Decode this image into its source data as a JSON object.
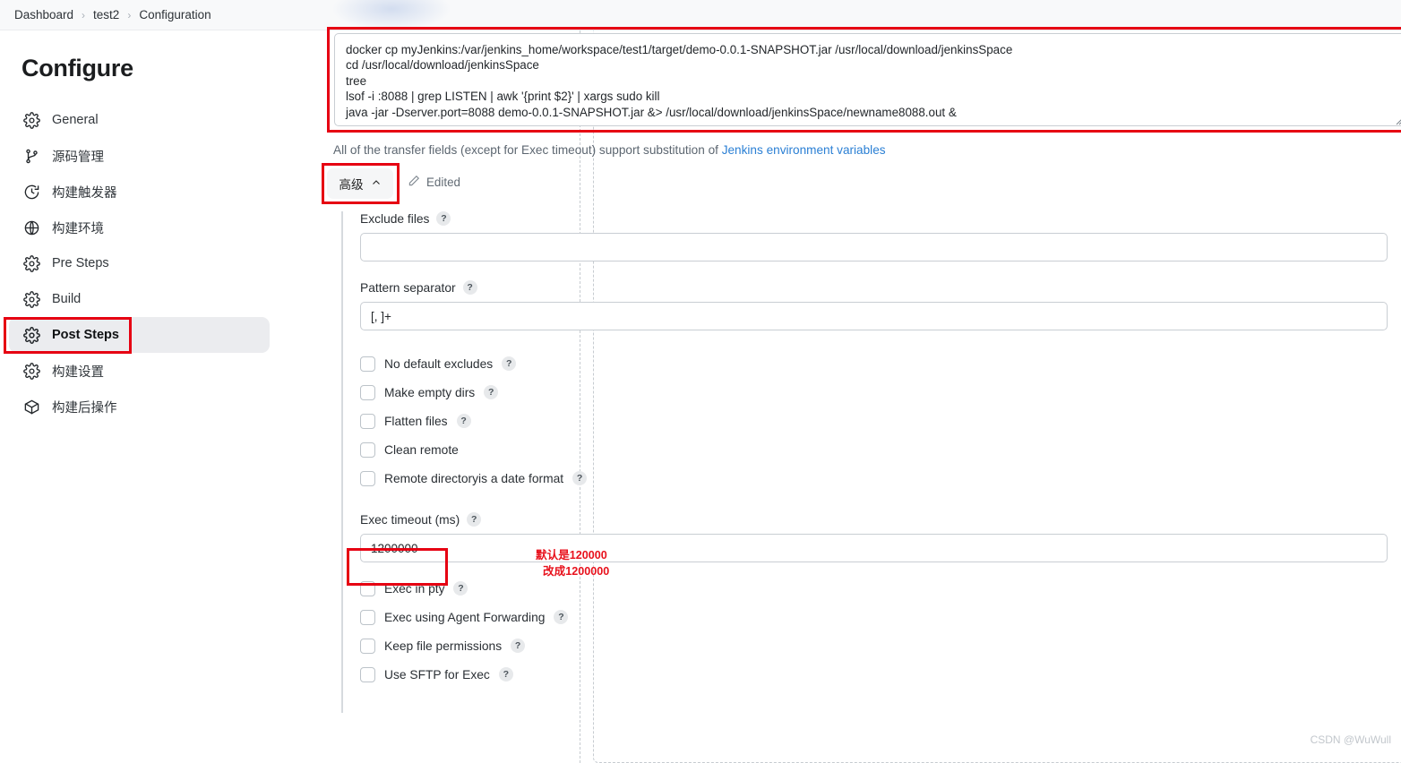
{
  "breadcrumb": {
    "items": [
      {
        "label": "Dashboard"
      },
      {
        "label": "test2"
      },
      {
        "label": "Configuration"
      }
    ],
    "separator": "›"
  },
  "sidebar": {
    "title": "Configure",
    "items": [
      {
        "label": "General",
        "icon": "gear-icon",
        "active": false
      },
      {
        "label": "源码管理",
        "icon": "source-branch-icon",
        "active": false
      },
      {
        "label": "构建触发器",
        "icon": "clock-icon",
        "active": false
      },
      {
        "label": "构建环境",
        "icon": "globe-icon",
        "active": false
      },
      {
        "label": "Pre Steps",
        "icon": "gear-icon",
        "active": false
      },
      {
        "label": "Build",
        "icon": "gear-icon",
        "active": false
      },
      {
        "label": "Post Steps",
        "icon": "gear-icon",
        "active": true
      },
      {
        "label": "构建设置",
        "icon": "gear-icon",
        "active": false
      },
      {
        "label": "构建后操作",
        "icon": "package-icon",
        "active": false
      }
    ]
  },
  "main": {
    "command_textarea": {
      "value": "docker cp myJenkins:/var/jenkins_home/workspace/test1/target/demo-0.0.1-SNAPSHOT.jar /usr/local/download/jenkinsSpace\ncd /usr/local/download/jenkinsSpace\ntree\nlsof -i :8088 | grep LISTEN | awk '{print $2}' | xargs sudo kill\njava -jar -Dserver.port=8088 demo-0.0.1-SNAPSHOT.jar &> /usr/local/download/jenkinsSpace/newname8088.out &",
      "placeholder": ""
    },
    "help_text_prefix": "All of the transfer fields (except for Exec timeout) support substitution of ",
    "help_link": "Jenkins environment variables",
    "advanced_button": "高级",
    "advanced_chevron": "chevron-up-icon",
    "edited_label": "Edited",
    "edited_icon": "pencil-icon",
    "fields": [
      {
        "label": "Exclude files",
        "value": "",
        "placeholder": "",
        "help": "?"
      },
      {
        "label": "Pattern separator",
        "value": "[, ]+",
        "placeholder": "",
        "help": "?"
      }
    ],
    "checkboxes_group1": [
      {
        "label": "No default excludes",
        "checked": false,
        "help": "?"
      },
      {
        "label": "Make empty dirs",
        "checked": false,
        "help": "?"
      },
      {
        "label": "Flatten files",
        "checked": false,
        "help": "?"
      },
      {
        "label": "Clean remote",
        "checked": false,
        "help": ""
      },
      {
        "label": "Remote directoryis a date format",
        "checked": false,
        "help": "?"
      }
    ],
    "exec_timeout": {
      "label": "Exec timeout (ms)",
      "help": "?",
      "value": "1200000",
      "placeholder": ""
    },
    "annotations": [
      {
        "text": "默认是120000"
      },
      {
        "text": "改成1200000"
      }
    ],
    "checkboxes_group2": [
      {
        "label": "Exec in pty",
        "checked": false,
        "help": "?"
      },
      {
        "label": "Exec using Agent Forwarding",
        "checked": false,
        "help": "?"
      },
      {
        "label": "Keep file permissions",
        "checked": false,
        "help": "?"
      },
      {
        "label": "Use SFTP for Exec",
        "checked": false,
        "help": "?"
      }
    ]
  },
  "watermark": "CSDN @WuWull",
  "colors": {
    "annotation_red": "#e8121d",
    "highlight_box": "#e60012",
    "link_blue": "#2a7fd4",
    "sidebar_active_bg": "#ebecef"
  }
}
